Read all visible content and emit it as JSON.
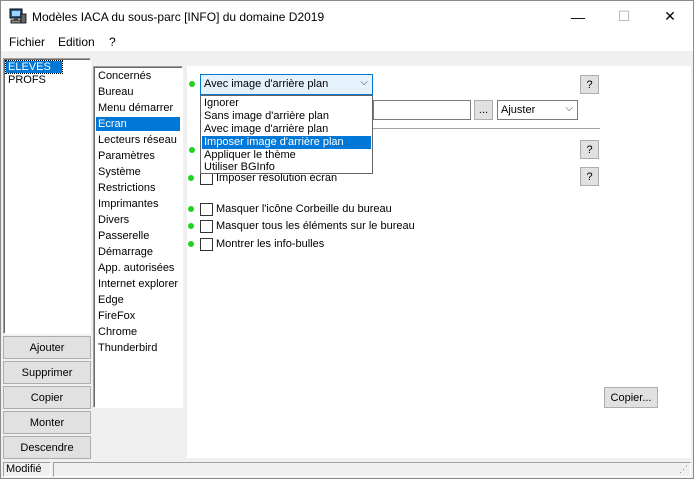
{
  "window": {
    "title": "Modèles IACA du sous-parc [INFO] du domaine D2019",
    "minimize_glyph": "—",
    "maximize_glyph": "☐",
    "close_glyph": "✕"
  },
  "menu": {
    "items": [
      {
        "label": "Fichier"
      },
      {
        "label": "Edition"
      },
      {
        "label": "?"
      }
    ]
  },
  "parc_list": {
    "items": [
      {
        "label": "ELEVES",
        "selected": true
      },
      {
        "label": "PROFS",
        "selected": false
      }
    ]
  },
  "left_buttons": [
    {
      "label": "Ajouter"
    },
    {
      "label": "Supprimer"
    },
    {
      "label": "Copier"
    },
    {
      "label": "Monter"
    },
    {
      "label": "Descendre"
    }
  ],
  "categories": {
    "items": [
      {
        "label": "Concernés"
      },
      {
        "label": "Bureau"
      },
      {
        "label": "Menu démarrer"
      },
      {
        "label": "Ecran",
        "selected": true
      },
      {
        "label": "Lecteurs réseau"
      },
      {
        "label": "Paramètres"
      },
      {
        "label": "Système"
      },
      {
        "label": "Restrictions"
      },
      {
        "label": "Imprimantes"
      },
      {
        "label": "Divers"
      },
      {
        "label": "Passerelle"
      },
      {
        "label": "Démarrage"
      },
      {
        "label": "App. autorisées"
      },
      {
        "label": "Internet explorer"
      },
      {
        "label": "Edge"
      },
      {
        "label": "FireFox"
      },
      {
        "label": "Chrome"
      },
      {
        "label": "Thunderbird"
      }
    ]
  },
  "ecran": {
    "background_combo": {
      "value": "Avec image d'arrière plan",
      "options": [
        {
          "label": "Ignorer"
        },
        {
          "label": "Sans image d'arrière plan"
        },
        {
          "label": "Avec image d'arrière plan"
        },
        {
          "label": "Imposer image d'arrière plan",
          "highlighted": true
        },
        {
          "label": "Appliquer le thème"
        },
        {
          "label": "Utiliser BGInfo"
        }
      ]
    },
    "image_path": {
      "value": ""
    },
    "browse_label": "...",
    "fit_combo": {
      "value": "Ajuster"
    },
    "help_label": "?",
    "partial_checkbox_label": "Imposer résolution écran",
    "checkboxes": [
      {
        "label": "Masquer l'icône Corbeille du bureau",
        "checked": false
      },
      {
        "label": "Masquer tous les éléments sur le bureau",
        "checked": false
      },
      {
        "label": "Montrer les info-bulles",
        "checked": false
      }
    ],
    "copy_button": "Copier..."
  },
  "status": {
    "text": "Modifié"
  },
  "colors": {
    "selection": "#0078d7",
    "indicator": "#1fd31f"
  }
}
